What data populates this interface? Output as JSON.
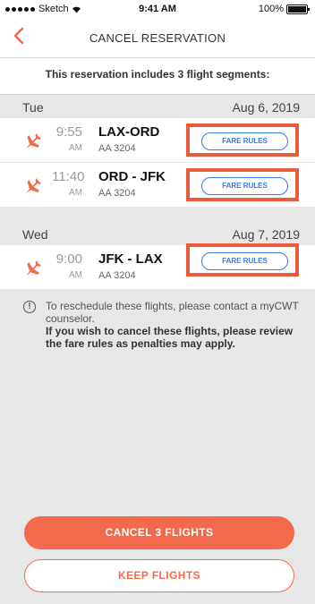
{
  "status_bar": {
    "carrier": "Sketch",
    "time": "9:41 AM",
    "battery": "100%"
  },
  "nav": {
    "title": "CANCEL RESERVATION",
    "back_icon": "chevron-left-icon"
  },
  "intro_text": "This reservation includes 3 flight segments:",
  "days": [
    {
      "day": "Tue",
      "date": "Aug 6, 2019",
      "flights": [
        {
          "time": "9:55",
          "ampm": "AM",
          "route": "LAX-ORD",
          "flight": "AA 3204",
          "fare_label": "FARE RULES"
        },
        {
          "time": "11:40",
          "ampm": "AM",
          "route": "ORD - JFK",
          "flight": "AA 3204",
          "fare_label": "FARE RULES"
        }
      ]
    },
    {
      "day": "Wed",
      "date": "Aug 7, 2019",
      "flights": [
        {
          "time": "9:00",
          "ampm": "AM",
          "route": "JFK - LAX",
          "flight": "AA 3204",
          "fare_label": "FARE RULES"
        }
      ]
    }
  ],
  "info": {
    "text": "To reschedule these flights, please contact a myCWT counselor.",
    "bold_text": "If you wish to cancel these flights, please review the fare rules as penalties may apply."
  },
  "buttons": {
    "cancel_label": "CANCEL 3 FLIGHTS",
    "keep_label": "KEEP FLIGHTS"
  },
  "colors": {
    "accent": "#f26a4b",
    "highlight": "#ea5a3d",
    "link_blue": "#3b78e7"
  }
}
